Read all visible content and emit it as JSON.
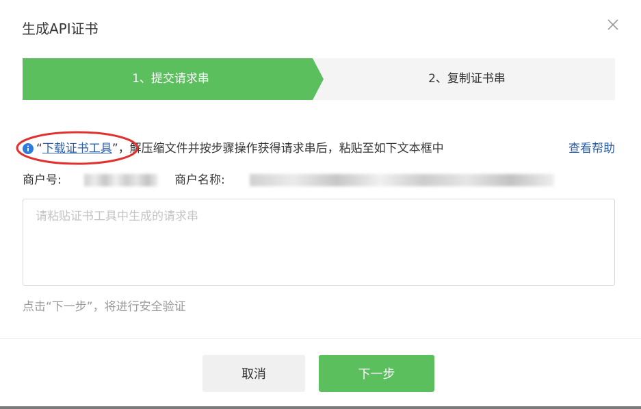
{
  "dialog": {
    "title": "生成API证书",
    "close_icon": "close-icon"
  },
  "steps": [
    {
      "label": "1、提交请求串",
      "active": true
    },
    {
      "label": "2、复制证书串",
      "active": false
    }
  ],
  "colors": {
    "accent_green": "#5bbf5e",
    "link_blue": "#2a5daa",
    "highlight_red": "#e0312f"
  },
  "info": {
    "icon": "info-icon",
    "quote_open": "“",
    "link_text": "下载证书工具",
    "rest_text": "”，解压缩文件并按步骤操作获得请求串后，粘贴至如下文本框中",
    "help_link": "查看帮助"
  },
  "merchant": {
    "id_label": "商户号:",
    "name_label": "商户名称:"
  },
  "request_input": {
    "placeholder": "请粘贴证书工具中生成的请求串",
    "value": ""
  },
  "hint": "点击“下一步”，将进行安全验证",
  "footer": {
    "cancel_label": "取消",
    "next_label": "下一步"
  }
}
